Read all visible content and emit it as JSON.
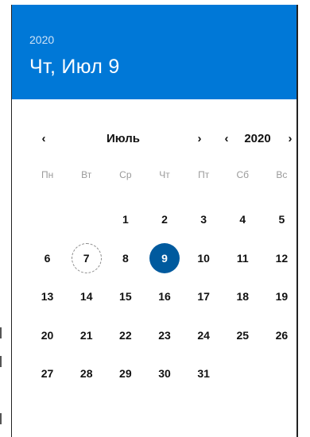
{
  "header": {
    "year": "2020",
    "selected_date": "Чт, Июл 9"
  },
  "nav": {
    "prev_month_icon": "‹",
    "month": "Июль",
    "next_month_icon": "›",
    "prev_year_icon": "‹",
    "year": "2020",
    "next_year_icon": "›"
  },
  "weekdays": [
    "Пн",
    "Вт",
    "Ср",
    "Чт",
    "Пт",
    "Сб",
    "Вс"
  ],
  "weeks": [
    [
      "",
      "",
      "1",
      "2",
      "3",
      "4",
      "5"
    ],
    [
      "6",
      "7",
      "8",
      "9",
      "10",
      "11",
      "12"
    ],
    [
      "13",
      "14",
      "15",
      "16",
      "17",
      "18",
      "19"
    ],
    [
      "20",
      "21",
      "22",
      "23",
      "24",
      "25",
      "26"
    ],
    [
      "27",
      "28",
      "29",
      "30",
      "31",
      "",
      ""
    ]
  ],
  "today_day": "7",
  "selected_day": "9",
  "colors": {
    "header_bg": "#0078d7",
    "selected_bg": "#005a9e",
    "weekday_text": "#9a9a9a"
  }
}
